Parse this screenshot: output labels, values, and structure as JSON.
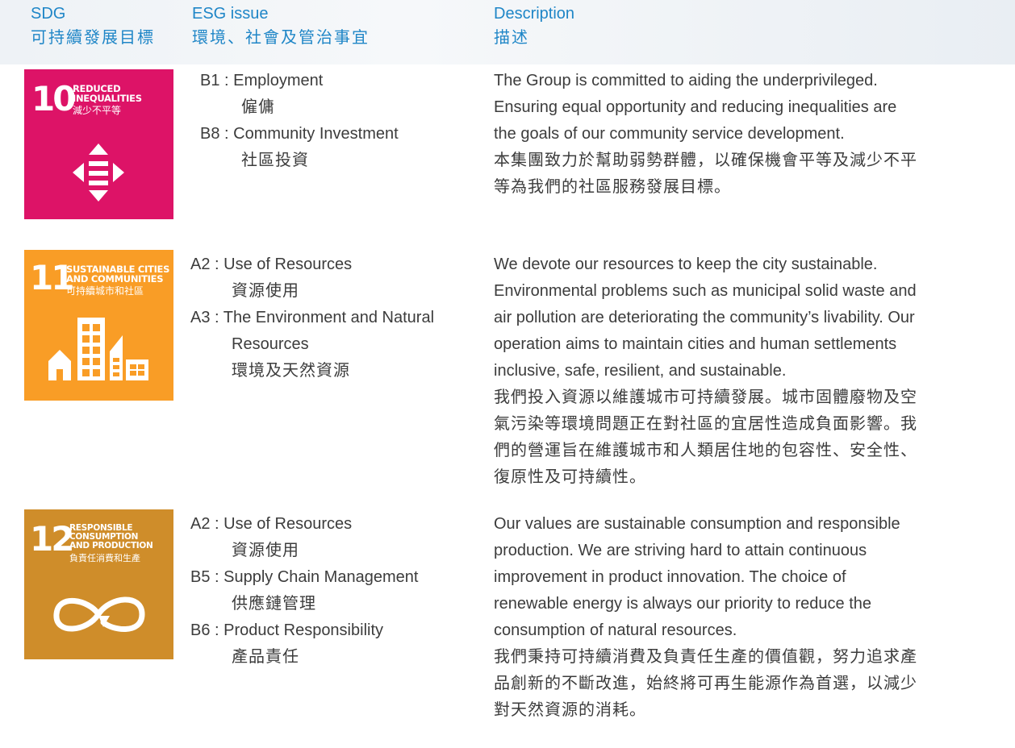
{
  "header": {
    "sdg_en": "SDG",
    "sdg_zh": "可持續發展目標",
    "esg_en": "ESG issue",
    "esg_zh": "環境、社會及管治事宜",
    "desc_en": "Description",
    "desc_zh": "描述"
  },
  "colors": {
    "header": "#1f86c7",
    "sdg10": "#dd1367",
    "sdg11": "#f99d26",
    "sdg12": "#cf8d2a",
    "body_text": "#3c3c3c"
  },
  "rows": [
    {
      "tile": {
        "number": "10",
        "title": [
          "REDUCED",
          "INEQUALITIES"
        ],
        "title_zh": "減少不平等",
        "icon": "inequality-arrows-icon"
      },
      "issues": [
        {
          "code": "B1 :",
          "en": [
            "Employment"
          ],
          "zh": "僱傭"
        },
        {
          "code": "B8 :",
          "en": [
            "Community Investment"
          ],
          "zh": "社區投資"
        }
      ],
      "description_en": [
        "The Group is committed to aiding the underprivileged.",
        "Ensuring equal opportunity and reducing inequalities are",
        "the goals of our community service development."
      ],
      "description_zh": [
        "本集團致力於幫助弱勢群體，以確保機會平等及減少不平",
        "等為我們的社區服務發展目標。"
      ]
    },
    {
      "tile": {
        "number": "11",
        "title": [
          "SUSTAINABLE CITIES",
          "AND COMMUNITIES"
        ],
        "title_zh": "可持續城市和社區",
        "icon": "city-buildings-icon"
      },
      "issues": [
        {
          "code": "A2 :",
          "en": [
            "Use of Resources"
          ],
          "zh": "資源使用"
        },
        {
          "code": "A3 :",
          "en": [
            "The Environment and Natural",
            "Resources"
          ],
          "zh": "環境及天然資源"
        }
      ],
      "description_en": [
        "We devote our resources to keep the city sustainable.",
        "Environmental problems such as municipal solid waste and",
        "air pollution are deteriorating the community’s livability. Our",
        "operation aims to maintain cities and human settlements",
        "inclusive, safe, resilient, and sustainable."
      ],
      "description_zh": [
        "我們投入資源以維護城市可持續發展。城市固體廢物及空",
        "氣污染等環境問題正在對社區的宜居性造成負面影響。我",
        "們的營運旨在維護城市和人類居住地的包容性、安全性、",
        "復原性及可持續性。"
      ]
    },
    {
      "tile": {
        "number": "12",
        "title": [
          "RESPONSIBLE",
          "CONSUMPTION",
          "AND PRODUCTION"
        ],
        "title_zh": "負責任消費和生產",
        "icon": "infinity-loop-icon"
      },
      "issues": [
        {
          "code": "A2 :",
          "en": [
            "Use of Resources"
          ],
          "zh": "資源使用"
        },
        {
          "code": "B5 :",
          "en": [
            "Supply Chain Management"
          ],
          "zh": "供應鏈管理"
        },
        {
          "code": "B6 :",
          "en": [
            "Product Responsibility"
          ],
          "zh": "產品責任"
        }
      ],
      "description_en": [
        "Our values are sustainable consumption and responsible",
        "production. We are striving hard to attain continuous",
        "improvement in product innovation. The choice of",
        "renewable energy is always our priority to reduce the",
        "consumption of natural resources."
      ],
      "description_zh": [
        "我們秉持可持續消費及負責任生產的價值觀，努力追求產",
        "品創新的不斷改進，始終將可再生能源作為首選，以減少",
        "對天然資源的消耗。"
      ]
    }
  ]
}
